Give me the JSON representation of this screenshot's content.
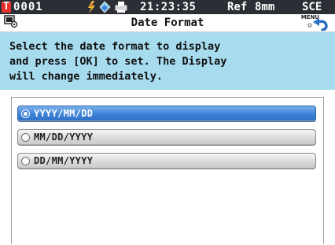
{
  "status_bar": {
    "target_icon": "T",
    "sample_number": "0001",
    "icons": [
      "lightning-icon",
      "calibration-icon",
      "printer-icon"
    ],
    "time": "21:23:35",
    "reference": "Ref",
    "aperture": "8mm",
    "mode": "SCE"
  },
  "title_bar": {
    "icon": "display-settings-icon",
    "title": "Date Format",
    "menu_label": "MENU"
  },
  "instruction": {
    "lines": [
      "Select the date format to display",
      "and press [OK] to set. The Display",
      "will change immediately."
    ]
  },
  "options": [
    {
      "label": "YYYY/MM/DD",
      "selected": true
    },
    {
      "label": "MM/DD/YYYY",
      "selected": false
    },
    {
      "label": "DD/MM/YYYY",
      "selected": false
    }
  ],
  "colors": {
    "status_bar_bg": "#2b2f35",
    "instruction_bg": "#a7dcef",
    "selected_option": "#3f83d8",
    "target_icon": "#e8312b"
  }
}
